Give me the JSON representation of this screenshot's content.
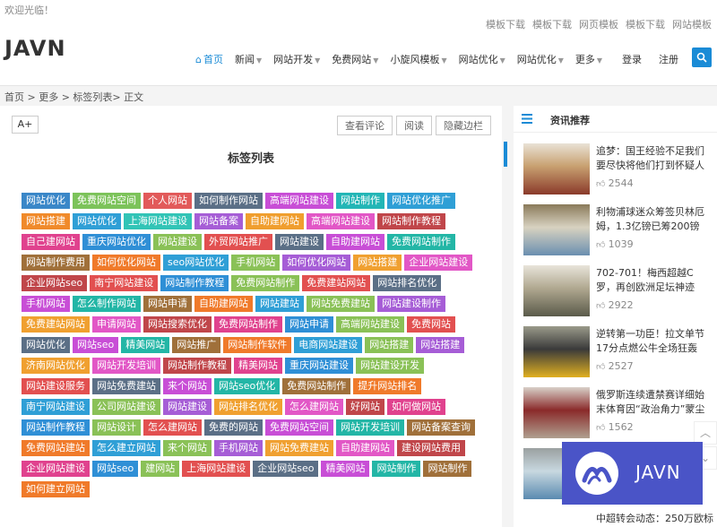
{
  "header": {
    "welcome": "欢迎光临！",
    "top_links": [
      "模板下载",
      "模板下载",
      "网页模板",
      "模板下载",
      "网站模板"
    ],
    "logo": "JAVN",
    "nav": [
      {
        "label": "首页",
        "active": true,
        "dropdown": false
      },
      {
        "label": "新闻",
        "active": false,
        "dropdown": true
      },
      {
        "label": "网站开发",
        "active": false,
        "dropdown": true
      },
      {
        "label": "免费网站",
        "active": false,
        "dropdown": true
      },
      {
        "label": "小旋风模板",
        "active": false,
        "dropdown": true
      },
      {
        "label": "网站优化",
        "active": false,
        "dropdown": true
      },
      {
        "label": "网站优化",
        "active": false,
        "dropdown": true
      },
      {
        "label": "更多",
        "active": false,
        "dropdown": true
      }
    ],
    "login": "登录",
    "register": "注册"
  },
  "breadcrumb": "首页 >  更多 >  标签列表> 正文",
  "toolbar": {
    "font_size": "A+",
    "buttons": [
      "查看评论",
      "阅读",
      "隐藏边栏"
    ]
  },
  "main": {
    "title": "标签列表",
    "tags": [
      {
        "t": "网站优化",
        "c": "#3a87c8"
      },
      {
        "t": "免费网站空间",
        "c": "#7cc35a"
      },
      {
        "t": "个人网站",
        "c": "#e25a5a"
      },
      {
        "t": "如何制作网站",
        "c": "#5b6f86"
      },
      {
        "t": "高端网站建设",
        "c": "#c84ed6"
      },
      {
        "t": "网站制作",
        "c": "#23b6b6"
      },
      {
        "t": "网站优化推广",
        "c": "#2f9fd6"
      },
      {
        "t": "网站搭建",
        "c": "#f08a2a"
      },
      {
        "t": "网站优化",
        "c": "#2f9fd6"
      },
      {
        "t": "上海网站建设",
        "c": "#32c4b6"
      },
      {
        "t": "网站备案",
        "c": "#a65dd6"
      },
      {
        "t": "自助建网站",
        "c": "#f09e2e"
      },
      {
        "t": "高端网站建设",
        "c": "#e257c6"
      },
      {
        "t": "网站制作教程",
        "c": "#c0464a"
      },
      {
        "t": "自己建网站",
        "c": "#e0428e"
      },
      {
        "t": "重庆网站优化",
        "c": "#2f8fd6"
      },
      {
        "t": "网站建设",
        "c": "#8ac157"
      },
      {
        "t": "外贸网站推广",
        "c": "#e25050"
      },
      {
        "t": "网站建设",
        "c": "#5b6f86"
      },
      {
        "t": "自助建网站",
        "c": "#c84ed6"
      },
      {
        "t": "免费网站制作",
        "c": "#23b6a6"
      },
      {
        "t": "网站制作费用",
        "c": "#a0703a"
      },
      {
        "t": "如何优化网站",
        "c": "#f07a2a"
      },
      {
        "t": "seo网站优化",
        "c": "#2f9fd6"
      },
      {
        "t": "手机网站",
        "c": "#8ac157"
      },
      {
        "t": "如何优化网站",
        "c": "#a65dd6"
      },
      {
        "t": "网站搭建",
        "c": "#f0a030"
      },
      {
        "t": "企业网站建设",
        "c": "#e257c6"
      },
      {
        "t": "企业网站seo",
        "c": "#c0464a"
      },
      {
        "t": "南宁网站建设",
        "c": "#e25050"
      },
      {
        "t": "网站制作教程",
        "c": "#2f8fd6"
      },
      {
        "t": "免费网站制作",
        "c": "#8ac157"
      },
      {
        "t": "免费建站网站",
        "c": "#e25050"
      },
      {
        "t": "网站排名优化",
        "c": "#5b6f86"
      },
      {
        "t": "手机网站",
        "c": "#c84ed6"
      },
      {
        "t": "怎么制作网站",
        "c": "#23b6a6"
      },
      {
        "t": "网站申请",
        "c": "#a0703a"
      },
      {
        "t": "自助建网站",
        "c": "#f07a2a"
      },
      {
        "t": "网站建站",
        "c": "#2f9fd6"
      },
      {
        "t": "网站免费建站",
        "c": "#8ac157"
      },
      {
        "t": "网站建设制作",
        "c": "#a65dd6"
      },
      {
        "t": "免费建站网站",
        "c": "#f0a030"
      },
      {
        "t": "申请网站",
        "c": "#e257c6"
      },
      {
        "t": "网站搜索优化",
        "c": "#c0464a"
      },
      {
        "t": "免费网站制作",
        "c": "#e0428e"
      },
      {
        "t": "网站申请",
        "c": "#2f8fd6"
      },
      {
        "t": "高端网站建设",
        "c": "#8ac157"
      },
      {
        "t": "免费网站",
        "c": "#e25050"
      },
      {
        "t": "网站优化",
        "c": "#5b6f86"
      },
      {
        "t": "网站seo",
        "c": "#c84ed6"
      },
      {
        "t": "精美网站",
        "c": "#23b6a6"
      },
      {
        "t": "网站推广",
        "c": "#a0703a"
      },
      {
        "t": "网站制作软件",
        "c": "#f07a2a"
      },
      {
        "t": "电商网站建设",
        "c": "#2f9fd6"
      },
      {
        "t": "网站搭建",
        "c": "#8ac157"
      },
      {
        "t": "网站搭建",
        "c": "#a65dd6"
      },
      {
        "t": "济南网站优化",
        "c": "#f0a030"
      },
      {
        "t": "网站开发培训",
        "c": "#e257c6"
      },
      {
        "t": "网站制作教程",
        "c": "#c0464a"
      },
      {
        "t": "精美网站",
        "c": "#e0428e"
      },
      {
        "t": "重庆网站建设",
        "c": "#2f8fd6"
      },
      {
        "t": "网站建设开发",
        "c": "#8ac157"
      },
      {
        "t": "网站建设服务",
        "c": "#e25050"
      },
      {
        "t": "网站免费建站",
        "c": "#5b6f86"
      },
      {
        "t": "来个网站",
        "c": "#c84ed6"
      },
      {
        "t": "网站seo优化",
        "c": "#23b6a6"
      },
      {
        "t": "免费网站制作",
        "c": "#a0703a"
      },
      {
        "t": "提升网站排名",
        "c": "#f07a2a"
      },
      {
        "t": "南宁网站建设",
        "c": "#2f9fd6"
      },
      {
        "t": "公司网站建设",
        "c": "#8ac157"
      },
      {
        "t": "网站建设",
        "c": "#a65dd6"
      },
      {
        "t": "网站排名优化",
        "c": "#f0a030"
      },
      {
        "t": "怎么建网站",
        "c": "#e257c6"
      },
      {
        "t": "好网站",
        "c": "#c0464a"
      },
      {
        "t": "如何做网站",
        "c": "#e0428e"
      },
      {
        "t": "网站制作教程",
        "c": "#2f8fd6"
      },
      {
        "t": "网站设计",
        "c": "#8ac157"
      },
      {
        "t": "怎么建网站",
        "c": "#e25050"
      },
      {
        "t": "免费的网站",
        "c": "#5b6f86"
      },
      {
        "t": "免费网站空间",
        "c": "#c84ed6"
      },
      {
        "t": "网站开发培训",
        "c": "#23b6a6"
      },
      {
        "t": "网站备案查询",
        "c": "#a0703a"
      },
      {
        "t": "免费网站建站",
        "c": "#f07a2a"
      },
      {
        "t": "怎么建立网站",
        "c": "#2f9fd6"
      },
      {
        "t": "来个网站",
        "c": "#8ac157"
      },
      {
        "t": "手机网站",
        "c": "#a65dd6"
      },
      {
        "t": "网站免费建站",
        "c": "#f0a030"
      },
      {
        "t": "自助建网站",
        "c": "#e257c6"
      },
      {
        "t": "建设网站费用",
        "c": "#c0464a"
      },
      {
        "t": "企业网站建设",
        "c": "#e0428e"
      },
      {
        "t": "网站seo",
        "c": "#2f8fd6"
      },
      {
        "t": "建网站",
        "c": "#8ac157"
      },
      {
        "t": "上海网站建设",
        "c": "#e25050"
      },
      {
        "t": "企业网站seo",
        "c": "#5b6f86"
      },
      {
        "t": "精美网站",
        "c": "#c84ed6"
      },
      {
        "t": "网站制作",
        "c": "#23b6a6"
      },
      {
        "t": "网站制作",
        "c": "#a0703a"
      },
      {
        "t": "如何建立网站",
        "c": "#f07a2a"
      }
    ]
  },
  "sidebar": {
    "title": "资讯推荐",
    "news": [
      {
        "title": "追梦：国王经验不足我们要尽快将他们打到怀疑人",
        "views": "2544"
      },
      {
        "title": "利物浦球迷众筹签贝林厄姆，1.3亿镑已筹200镑",
        "views": "1039"
      },
      {
        "title": "702-701！梅西超越C罗，再创欧洲足坛神迹",
        "views": "2922"
      },
      {
        "title": "逆转第一功臣！拉文单节17分点燃公牛全场狂轰",
        "views": "2527"
      },
      {
        "title": "俄罗斯连续遭禁赛详细始末体育因“政治角力”蒙尘",
        "views": "1562"
      },
      {
        "title": "",
        "views": ""
      }
    ],
    "bottom_item": "中超转会动态：250万欧标"
  },
  "watermark": "JAVN",
  "colors": {
    "accent": "#1a8bd6",
    "watermark_bg": "#4a54c7"
  }
}
